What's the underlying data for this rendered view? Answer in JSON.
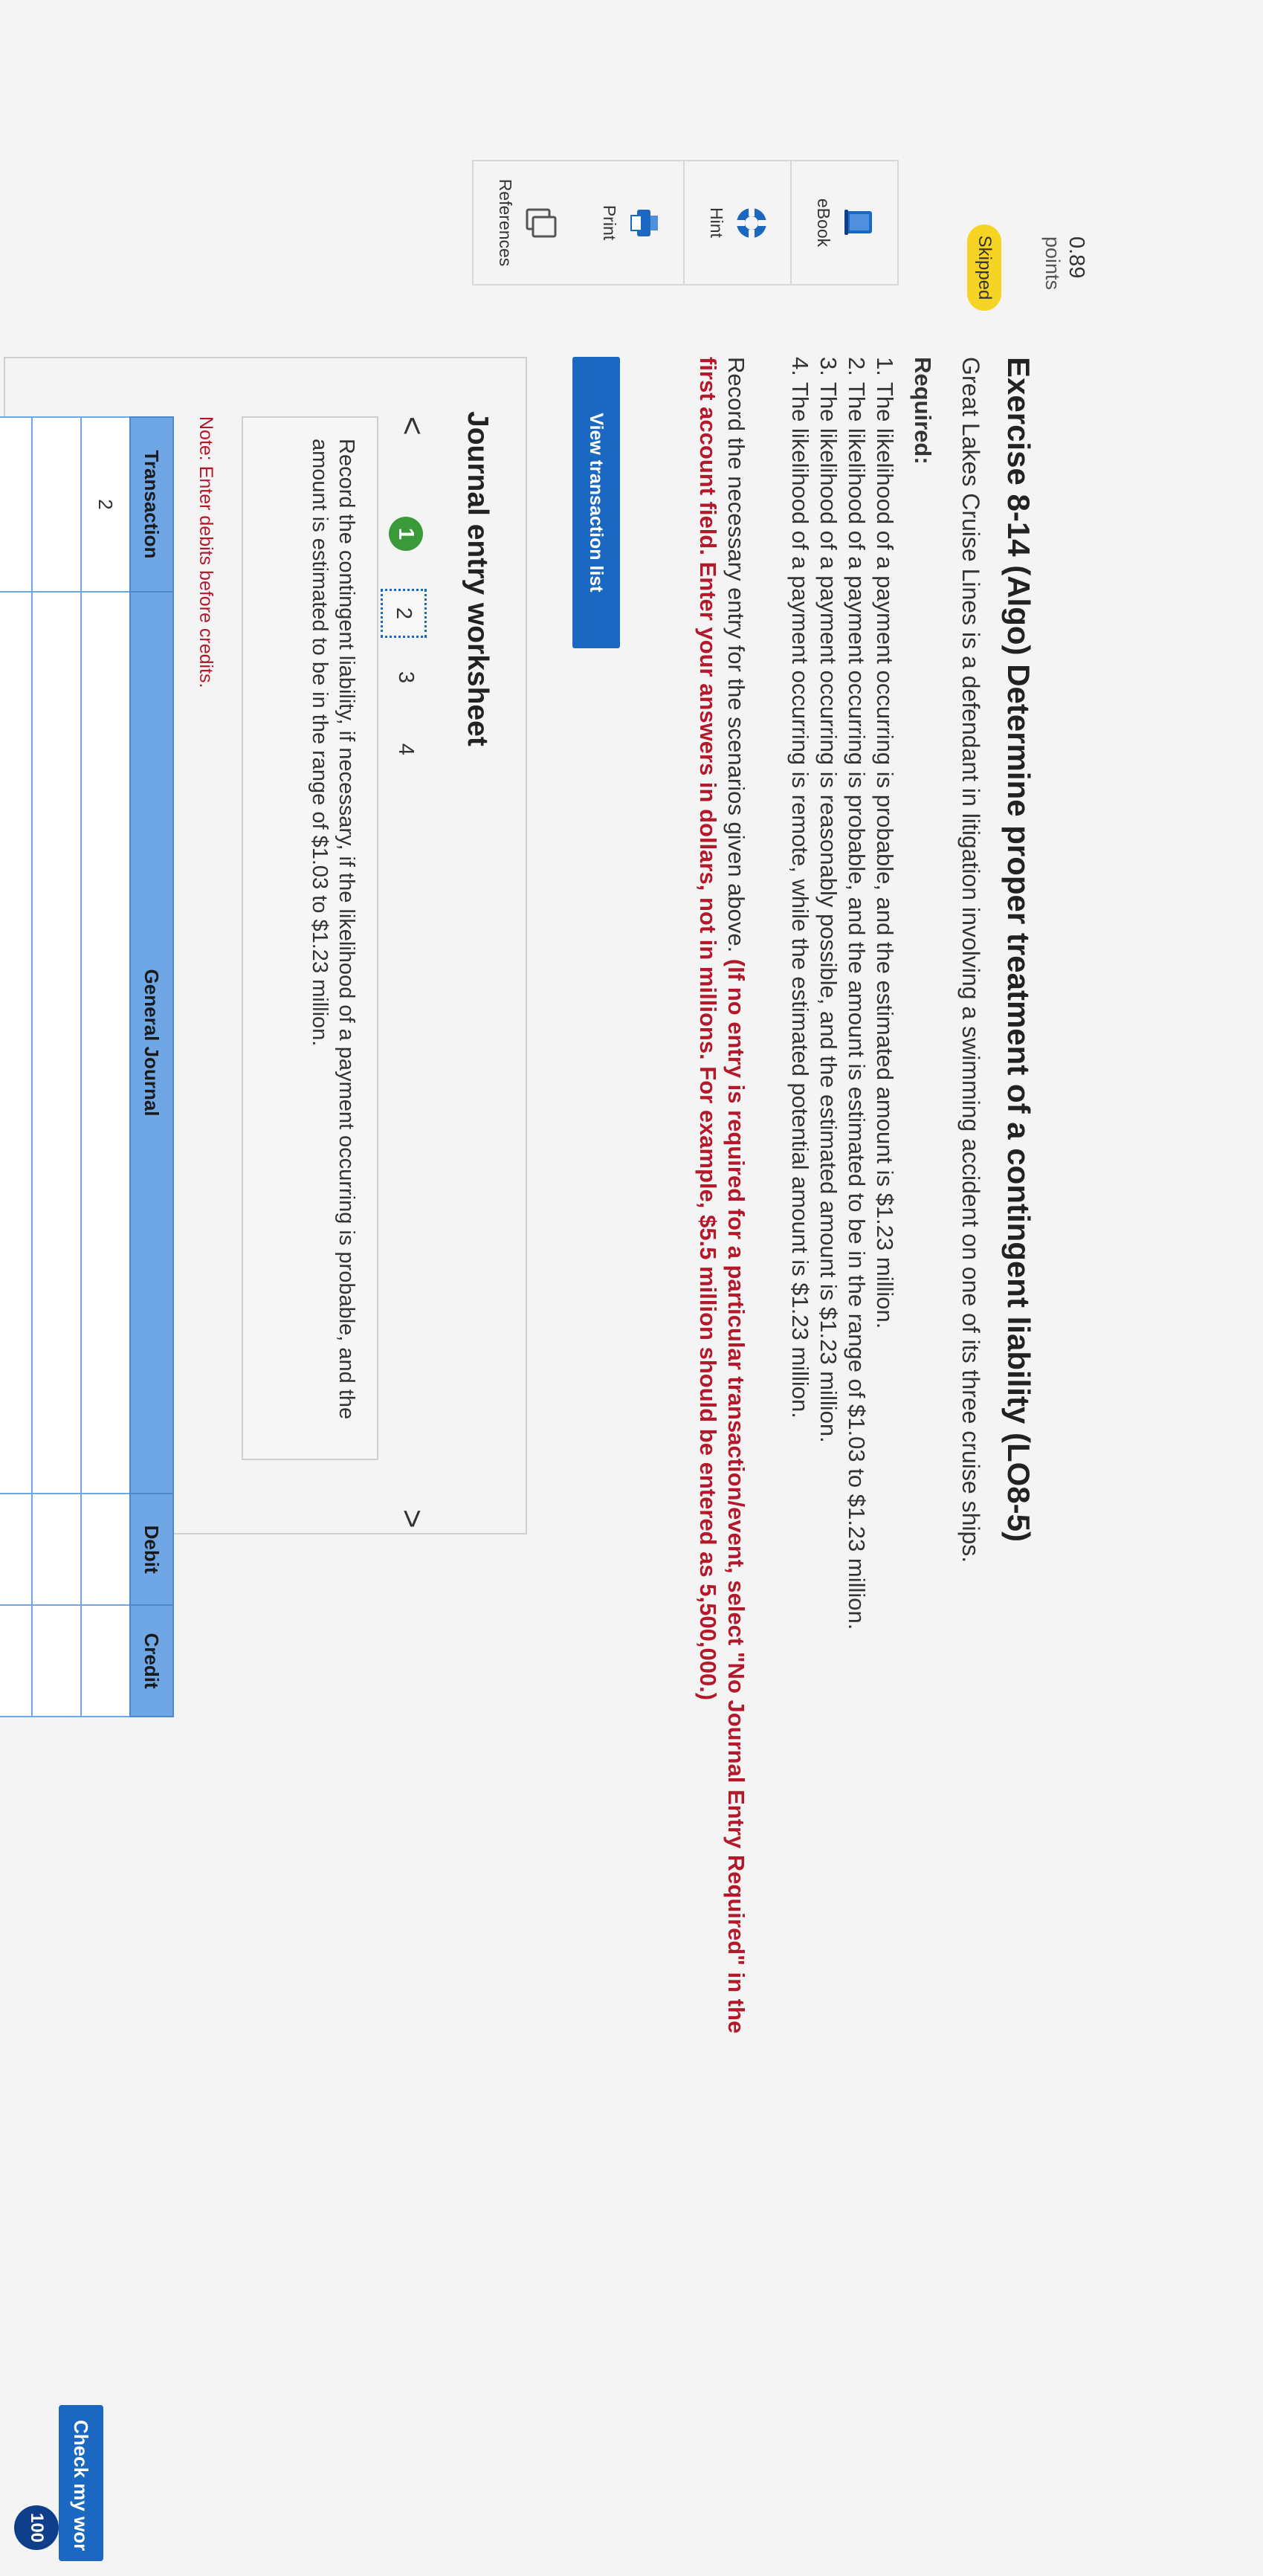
{
  "sidebar": {
    "points_value": "0.89",
    "points_label": "points",
    "status_badge": "Skipped",
    "tools": [
      {
        "label": "eBook",
        "icon": "book-icon"
      },
      {
        "label": "Hint",
        "icon": "lifebuoy-icon"
      },
      {
        "label": "Print",
        "icon": "printer-icon"
      },
      {
        "label": "References",
        "icon": "copy-icon"
      }
    ]
  },
  "question": {
    "title": "Exercise 8-14 (Algo) Determine proper treatment of a contingent liability (LO8-5)",
    "intro": "Great Lakes Cruise Lines is a defendant in litigation involving a swimming accident on one of its three cruise ships.",
    "required_label": "Required:",
    "requirements": [
      "1. The likelihood of a payment occurring is probable, and the estimated amount is $1.23 million.",
      "2. The likelihood of a payment occurring is probable, and the amount is estimated to be in the range of $1.03 to $1.23 million.",
      "3. The likelihood of a payment occurring is reasonably possible, and the estimated amount is $1.23 million.",
      "4. The likelihood of a payment occurring is remote, while the estimated potential amount is $1.23 million."
    ],
    "instruction_plain": "Record the necessary entry for the scenarios given above. ",
    "instruction_bold": "(If no entry is required for a particular transaction/event, select \"No Journal Entry Required\" in the first account field. Enter your answers in dollars, not in millions. For example, $5.5 million should be entered as 5,500,000.)",
    "view_button": "View transaction list"
  },
  "worksheet": {
    "title": "Journal entry worksheet",
    "prev_icon": "<",
    "next_icon": ">",
    "steps": [
      "1",
      "2",
      "3",
      "4"
    ],
    "active_step": "2",
    "description": "Record the contingent liability, if necessary, if the likelihood of a payment occurring is probable, and the amount is estimated to be in the range of $1.03 to $1.23 million.",
    "note": "Note: Enter debits before credits.",
    "table": {
      "headers": [
        "Transaction",
        "General Journal",
        "Debit",
        "Credit"
      ],
      "rows": [
        [
          "2",
          "",
          "",
          ""
        ],
        [
          "",
          "",
          "",
          ""
        ],
        [
          "",
          "",
          "",
          ""
        ],
        [
          "",
          "",
          "",
          ""
        ],
        [
          "",
          "",
          "",
          ""
        ],
        [
          "",
          "",
          "",
          ""
        ],
        [
          "",
          "",
          "",
          ""
        ],
        [
          "",
          "",
          "",
          ""
        ]
      ]
    }
  },
  "footer": {
    "check_button": "Check my wor",
    "badge": "100"
  },
  "colors": {
    "accent": "#1b68c2",
    "skipped": "#f5d423",
    "instruction_red": "#b4182b",
    "table_header": "#6fa6e6",
    "step_done": "#3a9a3a"
  }
}
